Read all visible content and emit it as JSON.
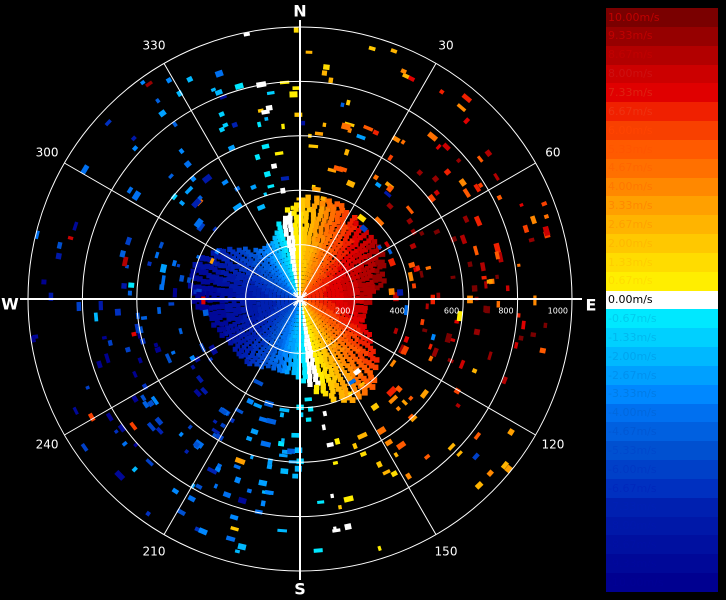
{
  "chart_data": {
    "type": "polar-scatter",
    "compass": {
      "north": "N",
      "east": "E",
      "south": "S",
      "west": "W"
    },
    "azimuth_ticks": [
      "30",
      "60",
      "120",
      "150",
      "210",
      "240",
      "300",
      "330"
    ],
    "range_ticks": [
      "200",
      "400",
      "600",
      "800",
      "1000"
    ],
    "range_max": 1000,
    "colorbar": {
      "unit": "m/s",
      "labels": [
        "10.00m/s",
        "9.33m/s",
        "8.67m/s",
        "8.00m/s",
        "7.33m/s",
        "6.67m/s",
        "6.00m/s",
        "5.33m/s",
        "4.67m/s",
        "4.00m/s",
        "3.33m/s",
        "2.67m/s",
        "2.00m/s",
        "1.33m/s",
        "0.67m/s",
        "0.00m/s",
        "-0.67m/s",
        "-1.33m/s",
        "-2.00m/s",
        "-2.67m/s",
        "-3.33m/s",
        "-4.00m/s",
        "-4.67m/s",
        "-5.33m/s",
        "-6.00m/s",
        "-6.67m/s",
        "-7.33m/s",
        "-8.00m/s",
        "-8.67m/s",
        "-9.33m/s",
        "-10.00m/s"
      ],
      "colors": [
        "#7a0000",
        "#960000",
        "#b20000",
        "#cc0000",
        "#e00000",
        "#f02000",
        "#f84000",
        "#ff5a00",
        "#ff7000",
        "#ff8800",
        "#ffa000",
        "#ffb400",
        "#ffc800",
        "#ffdc00",
        "#ffee00",
        "#ffffff",
        "#00e8ff",
        "#00d0ff",
        "#00b8ff",
        "#00a0ff",
        "#0088ff",
        "#0070f0",
        "#0060e0",
        "#0050d0",
        "#0040c8",
        "#0030c0",
        "#0020b0",
        "#0018a8",
        "#0010a0",
        "#000898",
        "#000090"
      ],
      "label_colors": [
        "#c00000",
        "#c00000",
        "#c00000",
        "#cc1111",
        "#dd2211",
        "#ee3311",
        "#ff4400",
        "#ff5500",
        "#ff6600",
        "#ff7700",
        "#ff8800",
        "#ffa000",
        "#ffb800",
        "#ffcc00",
        "#ffdd00",
        "#ffffff",
        "#00ccee",
        "#00b8ee",
        "#00a4ee",
        "#0090ee",
        "#007ce6",
        "#0068dd",
        "#0058d4",
        "#0048cc",
        "#0038c4",
        "#0028bc",
        "#0020b4",
        "#0018ac",
        "#0010a4",
        "#00089c",
        "#000094"
      ]
    }
  }
}
